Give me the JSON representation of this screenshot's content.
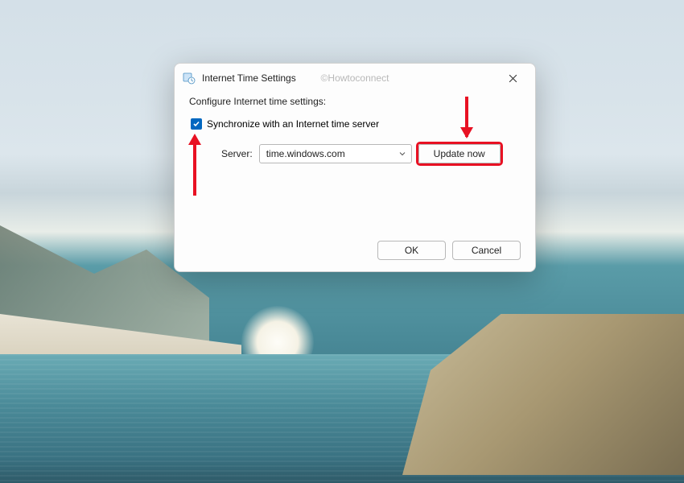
{
  "dialog": {
    "title": "Internet Time Settings",
    "watermark": "©Howtoconnect",
    "instruction": "Configure Internet time settings:",
    "checkbox": {
      "label": "Synchronize with an Internet time server",
      "checked": true
    },
    "server": {
      "label": "Server:",
      "value": "time.windows.com"
    },
    "update_button": "Update now",
    "ok_button": "OK",
    "cancel_button": "Cancel"
  }
}
